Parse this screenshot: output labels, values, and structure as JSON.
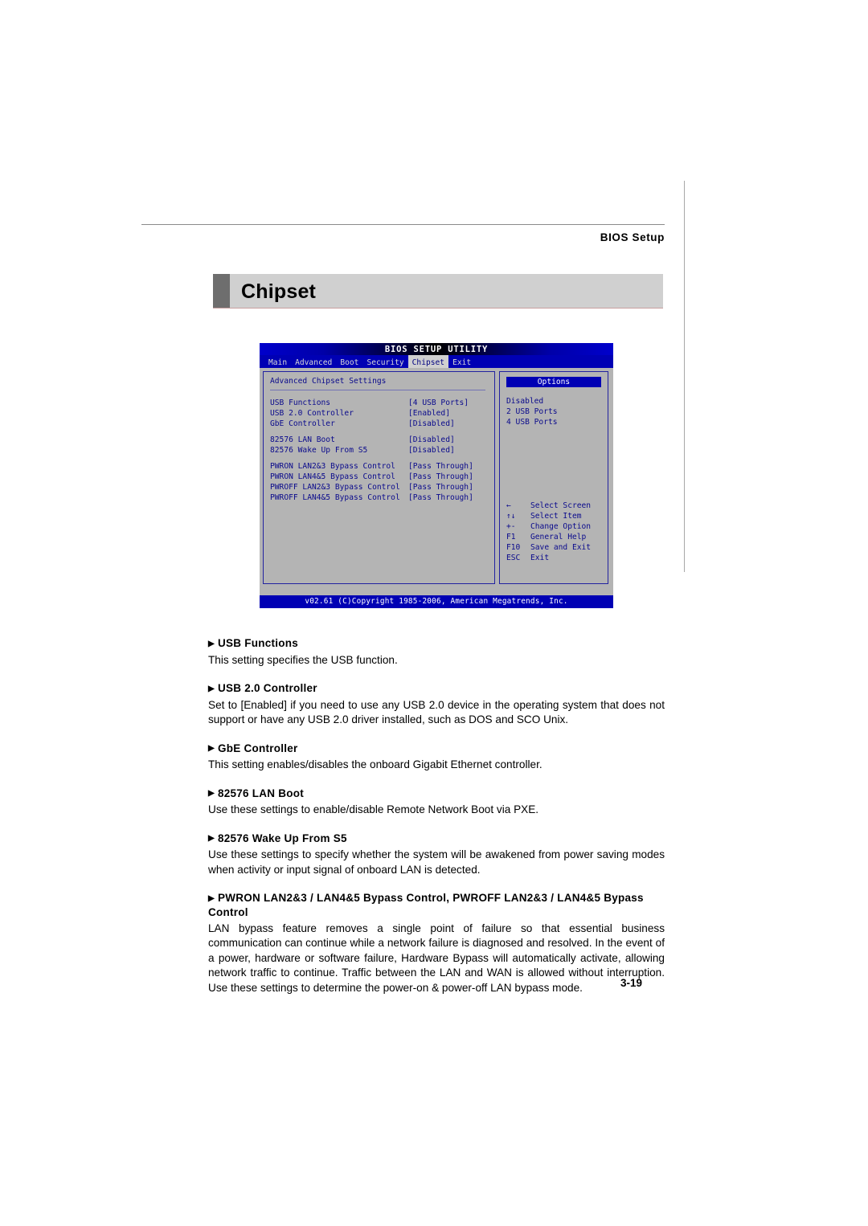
{
  "page": {
    "header_label": "BIOS Setup",
    "banner_title": "Chipset",
    "page_number": "3-19"
  },
  "bios": {
    "title": "BIOS SETUP UTILITY",
    "tabs": [
      {
        "label": "Main",
        "active": false
      },
      {
        "label": "Advanced",
        "active": false
      },
      {
        "label": "Boot",
        "active": false
      },
      {
        "label": "Security",
        "active": false
      },
      {
        "label": "Chipset",
        "active": true
      },
      {
        "label": "Exit",
        "active": false
      }
    ],
    "section_title": "Advanced Chipset Settings",
    "settings": [
      {
        "name": "USB Functions",
        "value": "[4 USB Ports]"
      },
      {
        "name": "USB 2.0 Controller",
        "value": "[Enabled]"
      },
      {
        "name": "GbE Controller",
        "value": "[Disabled]"
      },
      {
        "name": "82576 LAN Boot",
        "value": "[Disabled]"
      },
      {
        "name": "82576 Wake Up From S5",
        "value": "[Disabled]"
      },
      {
        "name": "PWRON LAN2&3 Bypass Control",
        "value": "[Pass Through]"
      },
      {
        "name": "PWRON LAN4&5 Bypass Control",
        "value": "[Pass Through]"
      },
      {
        "name": "PWROFF LAN2&3 Bypass Control",
        "value": "[Pass Through]"
      },
      {
        "name": "PWROFF LAN4&5 Bypass Control",
        "value": "[Pass Through]"
      }
    ],
    "options_header": "Options",
    "options": [
      "Disabled",
      "2 USB Ports",
      "4 USB Ports"
    ],
    "legend": [
      {
        "key": "←",
        "text": "Select Screen"
      },
      {
        "key": "↑↓",
        "text": "Select Item"
      },
      {
        "key": "+-",
        "text": "Change Option"
      },
      {
        "key": "F1",
        "text": "General Help"
      },
      {
        "key": "F10",
        "text": "Save and Exit"
      },
      {
        "key": "ESC",
        "text": "Exit"
      }
    ],
    "footer": "v02.61 (C)Copyright 1985-2006, American Megatrends, Inc."
  },
  "doc": {
    "sections": [
      {
        "heading": "USB Functions",
        "body": "This setting specifies the USB function."
      },
      {
        "heading": "USB 2.0 Controller",
        "body": "Set to [Enabled] if you need to use any USB 2.0 device in the operating system that does not support or have any USB 2.0 driver installed, such as DOS and SCO Unix."
      },
      {
        "heading": "GbE Controller",
        "body": "This setting enables/disables the onboard Gigabit Ethernet controller."
      },
      {
        "heading": "82576 LAN Boot",
        "body": "Use these settings to enable/disable Remote Network Boot via PXE."
      },
      {
        "heading": "82576 Wake Up From S5",
        "body": "Use these settings to specify whether the system will be awakened from power saving modes when activity or input signal of onboard LAN is detected."
      },
      {
        "heading": "PWRON LAN2&3 / LAN4&5 Bypass Control, PWROFF LAN2&3 / LAN4&5 Bypass Control",
        "body": "LAN bypass feature removes a single point of failure so that essential business communication can continue while a network failure is diagnosed and resolved. In the event of a power, hardware or software failure, Hardware Bypass will automatically activate, allowing network traffic to continue. Traffic between the LAN and WAN is allowed without interruption. Use these settings to determine the power-on & power-off LAN bypass mode."
      }
    ]
  },
  "colors": {
    "bios_blue": "#0000b4",
    "bios_text": "#0a0a8c",
    "bios_bg": "#b4b4b4",
    "banner_bg": "#d0d0d0",
    "banner_block": "#6e6e6e"
  }
}
